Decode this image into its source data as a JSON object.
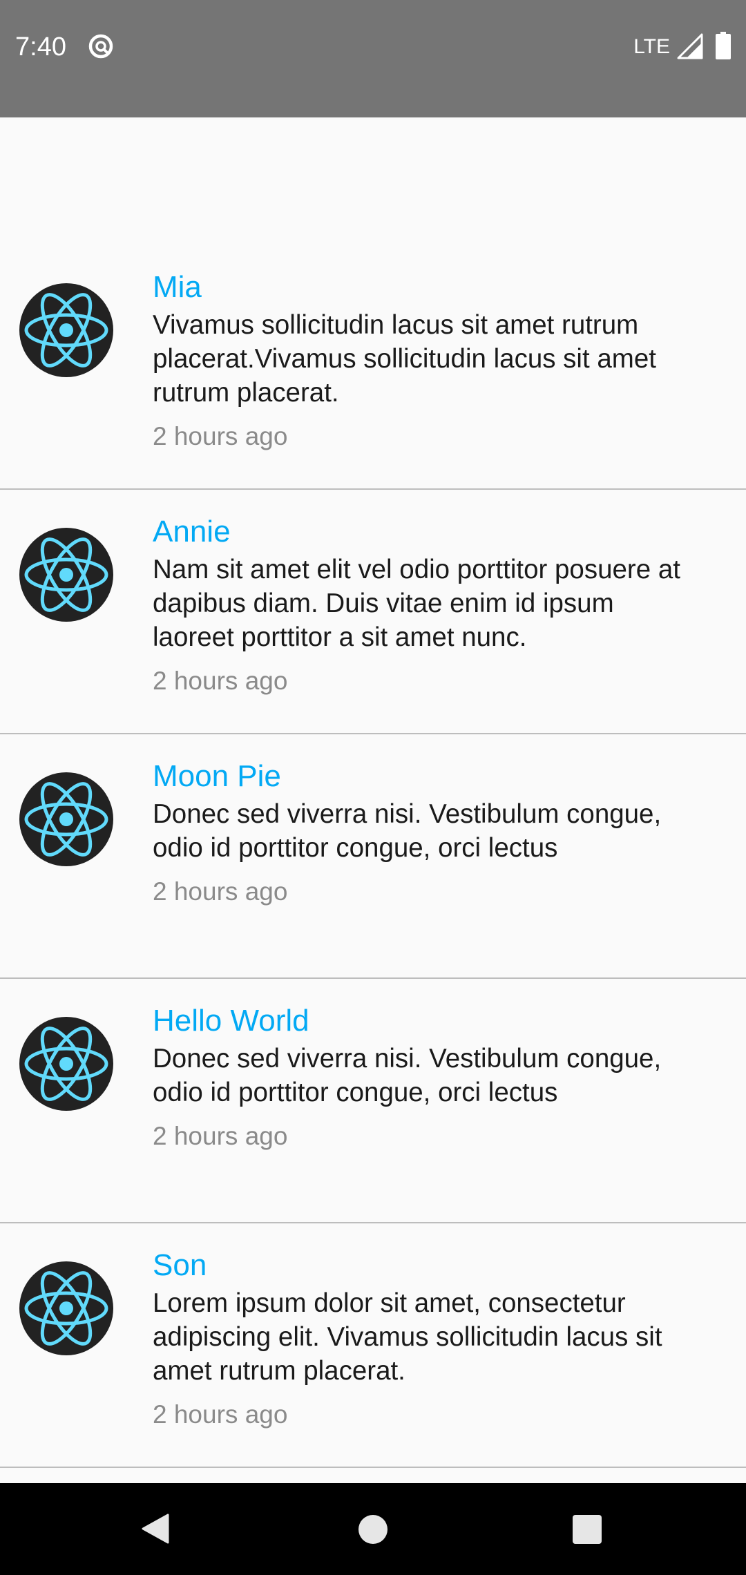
{
  "status_bar": {
    "time": "7:40",
    "network": "LTE",
    "sync_icon": "sync-icon",
    "signal_icon": "signal-icon",
    "battery_icon": "battery-icon"
  },
  "list": {
    "items": [
      {
        "name": "",
        "message": "adipiscing elit. Vivamus sollicitudin lacus sit amet rutrum placerat.",
        "time": "2 hours ago"
      },
      {
        "name": "Mia",
        "message": "Vivamus sollicitudin lacus sit amet rutrum placerat.Vivamus sollicitudin lacus sit amet rutrum placerat.",
        "time": "2 hours ago"
      },
      {
        "name": "Annie",
        "message": "Nam sit amet elit vel odio porttitor posuere at dapibus diam. Duis vitae enim id ipsum laoreet porttitor a sit amet nunc.",
        "time": "2 hours ago"
      },
      {
        "name": "Moon Pie",
        "message": "Donec sed viverra nisi. Vestibulum congue, odio id porttitor congue, orci lectus",
        "time": "2 hours ago"
      },
      {
        "name": "Hello World",
        "message": "Donec sed viverra nisi. Vestibulum congue, odio id porttitor congue, orci lectus",
        "time": "2 hours ago"
      },
      {
        "name": "Son",
        "message": "Lorem ipsum dolor sit amet, consectetur adipiscing elit. Vivamus sollicitudin lacus sit amet rutrum placerat.",
        "time": "2 hours ago"
      }
    ]
  },
  "nav_bar": {
    "back_icon": "back-icon",
    "home_icon": "home-icon",
    "recents_icon": "recents-icon"
  },
  "colors": {
    "status_bar": "#757575",
    "name": "#03a9f4",
    "avatar_bg": "#222222",
    "react_logo": "#61dafb",
    "timestamp": "#8a8a8a",
    "divider": "#bdbdbd",
    "background": "#fafafa"
  }
}
